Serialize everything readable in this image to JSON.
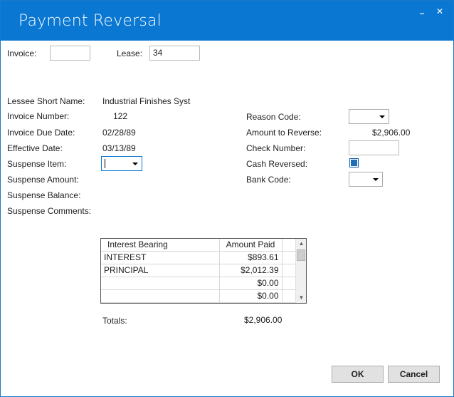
{
  "window": {
    "title": "Payment Reversal",
    "minimize_glyph": "_",
    "close_glyph": "✕"
  },
  "header": {
    "invoice_label": "Invoice:",
    "invoice_value": "",
    "lease_label": "Lease:",
    "lease_value": "34"
  },
  "left": {
    "lessee_short_name_label": "Lessee Short Name:",
    "lessee_short_name_value": "Industrial Finishes Syst",
    "invoice_number_label": "Invoice Number:",
    "invoice_number_value": "122",
    "invoice_due_date_label": "Invoice Due Date:",
    "invoice_due_date_value": "02/28/89",
    "effective_date_label": "Effective Date:",
    "effective_date_value": "03/13/89",
    "suspense_item_label": "Suspense Item:",
    "suspense_item_value": "",
    "suspense_amount_label": "Suspense Amount:",
    "suspense_balance_label": "Suspense Balance:",
    "suspense_comments_label": "Suspense Comments:"
  },
  "right": {
    "reason_code_label": "Reason Code:",
    "reason_code_value": "",
    "amount_to_reverse_label": "Amount to Reverse:",
    "amount_to_reverse_value": "$2,906.00",
    "check_number_label": "Check Number:",
    "check_number_value": "",
    "cash_reversed_label": "Cash Reversed:",
    "cash_reversed_checked": true,
    "bank_code_label": "Bank Code:",
    "bank_code_value": ""
  },
  "grid": {
    "columns": [
      "Interest Bearing",
      "Amount Paid"
    ],
    "rows": [
      {
        "name": "INTEREST",
        "amount": "$893.61"
      },
      {
        "name": "PRINCIPAL",
        "amount": "$2,012.39"
      },
      {
        "name": "",
        "amount": "$0.00"
      },
      {
        "name": "",
        "amount": "$0.00"
      }
    ]
  },
  "totals": {
    "label": "Totals:",
    "value": "$2,906.00"
  },
  "buttons": {
    "ok_label": "OK",
    "cancel_label": "Cancel"
  },
  "colors": {
    "titlebar": "#0a78d2",
    "checkbox_fill": "#1f6fb7"
  },
  "icons": {
    "minimize": "minimize-icon",
    "close": "close-icon",
    "dropdown": "chevron-down-icon",
    "scroll_up": "scroll-up-arrow-icon",
    "scroll_down": "scroll-down-arrow-icon"
  }
}
